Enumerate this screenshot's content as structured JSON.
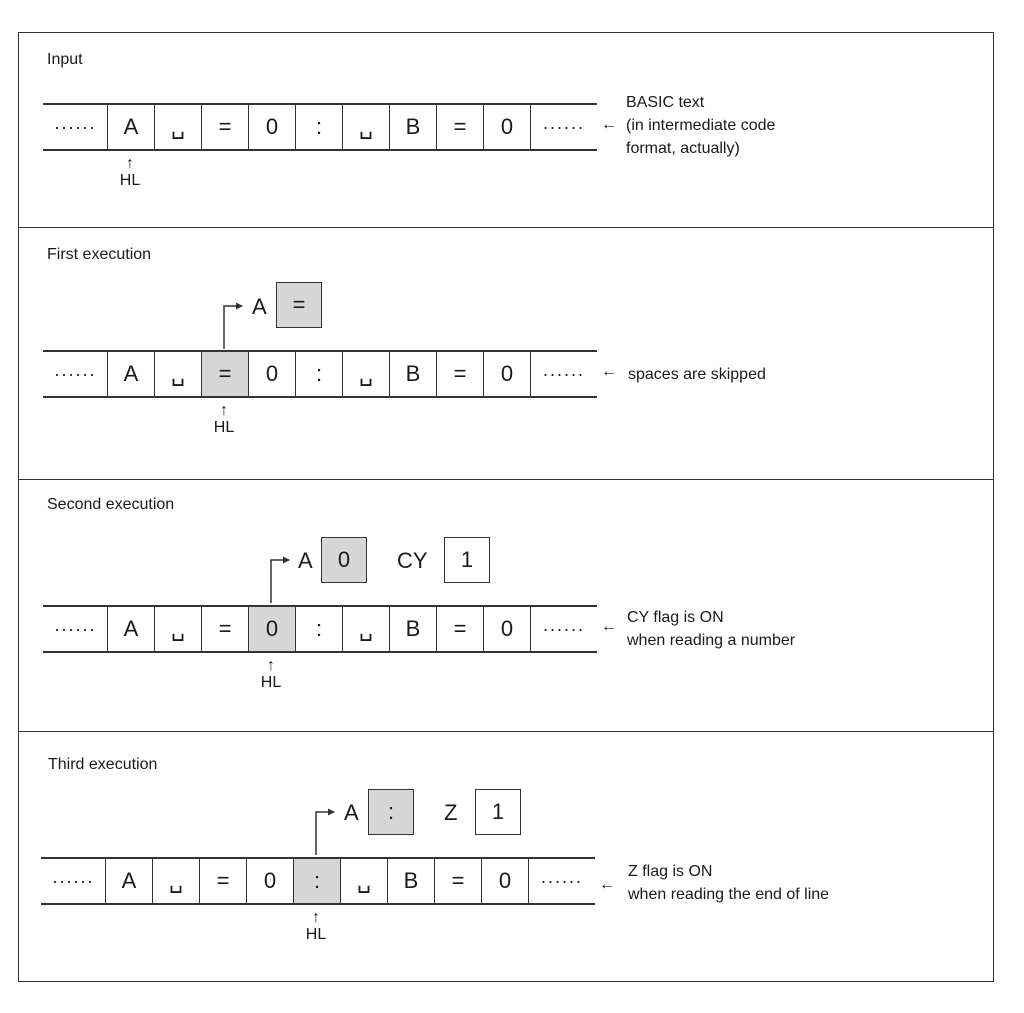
{
  "panels": [
    {
      "title": "Input",
      "left_dots": "······",
      "right_dots": "······",
      "cells": [
        "A",
        "␣",
        "=",
        "0",
        ":",
        "␣",
        "B",
        "=",
        "0"
      ],
      "note": [
        "BASIC text",
        "(in intermediate code",
        "format, actually)"
      ],
      "hl_label": "HL",
      "hl_arrow": "↑",
      "note_arrow": "←"
    },
    {
      "title": "First execution",
      "left_dots": "······",
      "right_dots": "······",
      "cells": [
        "A",
        "␣",
        "=",
        "0",
        ":",
        "␣",
        "B",
        "=",
        "0"
      ],
      "highlighted_cell": "=",
      "register": {
        "name": "A",
        "value": "="
      },
      "note": [
        "spaces are skipped"
      ],
      "hl_label": "HL",
      "hl_arrow": "↑",
      "note_arrow": "←"
    },
    {
      "title": "Second execution",
      "left_dots": "······",
      "right_dots": "······",
      "cells": [
        "A",
        "␣",
        "=",
        "0",
        ":",
        "␣",
        "B",
        "=",
        "0"
      ],
      "highlighted_cell": "0",
      "register": {
        "name": "A",
        "value": "0"
      },
      "flag": {
        "name": "CY",
        "value": "1"
      },
      "note": [
        "CY flag is ON",
        "when reading a number"
      ],
      "hl_label": "HL",
      "hl_arrow": "↑",
      "note_arrow": "←"
    },
    {
      "title": "Third execution",
      "left_dots": "······",
      "right_dots": "······",
      "cells": [
        "A",
        "␣",
        "=",
        "0",
        ":",
        "␣",
        "B",
        "=",
        "0"
      ],
      "highlighted_cell": ":",
      "register": {
        "name": "A",
        "value": ":"
      },
      "flag": {
        "name": "Z",
        "value": "1"
      },
      "note": [
        "Z flag is ON",
        "when reading the end of line"
      ],
      "hl_label": "HL",
      "hl_arrow": "↑",
      "note_arrow": "←"
    }
  ]
}
